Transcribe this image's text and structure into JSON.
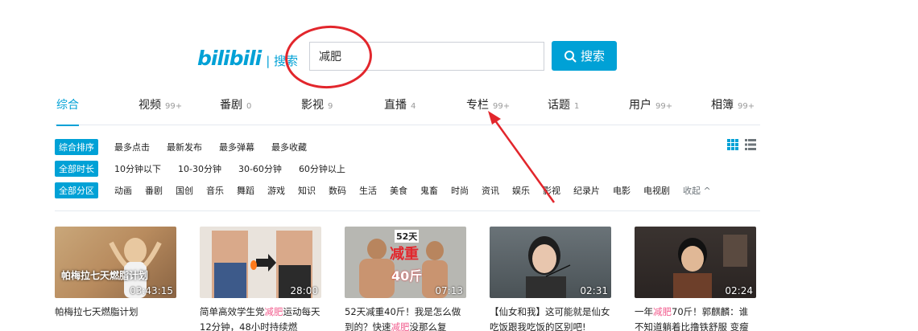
{
  "header": {
    "logo": "bilibili",
    "logo_sub": "| 搜索",
    "search_value": "减肥",
    "search_button": "搜索"
  },
  "tabs": [
    {
      "label": "综合",
      "count": ""
    },
    {
      "label": "视频",
      "count": "99+"
    },
    {
      "label": "番剧",
      "count": "0"
    },
    {
      "label": "影视",
      "count": "9"
    },
    {
      "label": "直播",
      "count": "4"
    },
    {
      "label": "专栏",
      "count": "99+"
    },
    {
      "label": "话题",
      "count": "1"
    },
    {
      "label": "用户",
      "count": "99+"
    },
    {
      "label": "相簿",
      "count": "99+"
    }
  ],
  "filters": {
    "sort": {
      "active": "综合排序",
      "options": [
        "最多点击",
        "最新发布",
        "最多弹幕",
        "最多收藏"
      ]
    },
    "duration": {
      "active": "全部时长",
      "options": [
        "10分钟以下",
        "10-30分钟",
        "30-60分钟",
        "60分钟以上"
      ]
    },
    "zone": {
      "active": "全部分区",
      "options": [
        "动画",
        "番剧",
        "国创",
        "音乐",
        "舞蹈",
        "游戏",
        "知识",
        "数码",
        "生活",
        "美食",
        "鬼畜",
        "时尚",
        "资讯",
        "娱乐",
        "影视",
        "纪录片",
        "电影",
        "电视剧"
      ],
      "collapse": "收起 ^"
    }
  },
  "videos": [
    {
      "duration": "03:43:15",
      "caption": "帕梅拉七天燃脂计划",
      "title_pre": "帕梅拉七天燃脂计划",
      "title_hl": "",
      "title_post": ""
    },
    {
      "duration": "28:00",
      "caption": "",
      "title_pre": "简单高效学生党",
      "title_hl": "减肥",
      "title_post": "运动每天12分钟，48小时持续燃"
    },
    {
      "duration": "07:13",
      "caption": "52天",
      "caption2": "减重",
      "caption3": "40斤",
      "title_pre": "52天减重40斤！我是怎么做到的？快速",
      "title_hl": "减肥",
      "title_post": "没那么复"
    },
    {
      "duration": "02:31",
      "caption": "",
      "title_pre": "【仙女和我】这可能就是仙女吃饭跟我吃饭的区别吧!",
      "title_hl": "",
      "title_post": ""
    },
    {
      "duration": "02:24",
      "caption": "",
      "title_pre": "一年",
      "title_hl": "减肥",
      "title_post": "70斤！郭麒麟：谁不知道躺着比撸铁舒服 变瘦"
    }
  ]
}
